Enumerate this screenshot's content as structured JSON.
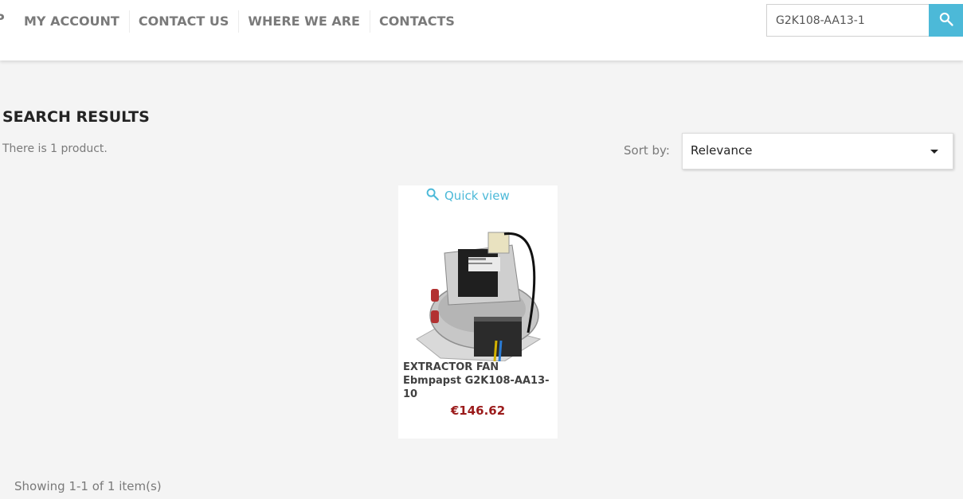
{
  "header": {
    "nav_cut_text": "P",
    "nav": [
      "MY ACCOUNT",
      "CONTACT US",
      "WHERE WE ARE",
      "CONTACTS"
    ],
    "search": {
      "value": "G2K108-AA13-1"
    },
    "search_button_icon": "search-icon"
  },
  "main": {
    "title": "SEARCH RESULTS",
    "count_text": "There is 1 product.",
    "sort_label": "Sort by:",
    "sort_value": "Relevance",
    "sort_icon": "caret-down-icon"
  },
  "products": [
    {
      "quick_view_label": "Quick view",
      "quick_view_icon": "search-icon",
      "name": "EXTRACTOR FAN Ebmpapst G2K108-AA13-10",
      "price": "€146.62"
    }
  ],
  "footer": {
    "pagination_text": "Showing 1-1 of 1 item(s)"
  },
  "colors": {
    "accent": "#4cb9d8",
    "price": "#9b1b1b",
    "background": "#f4f4f4"
  }
}
